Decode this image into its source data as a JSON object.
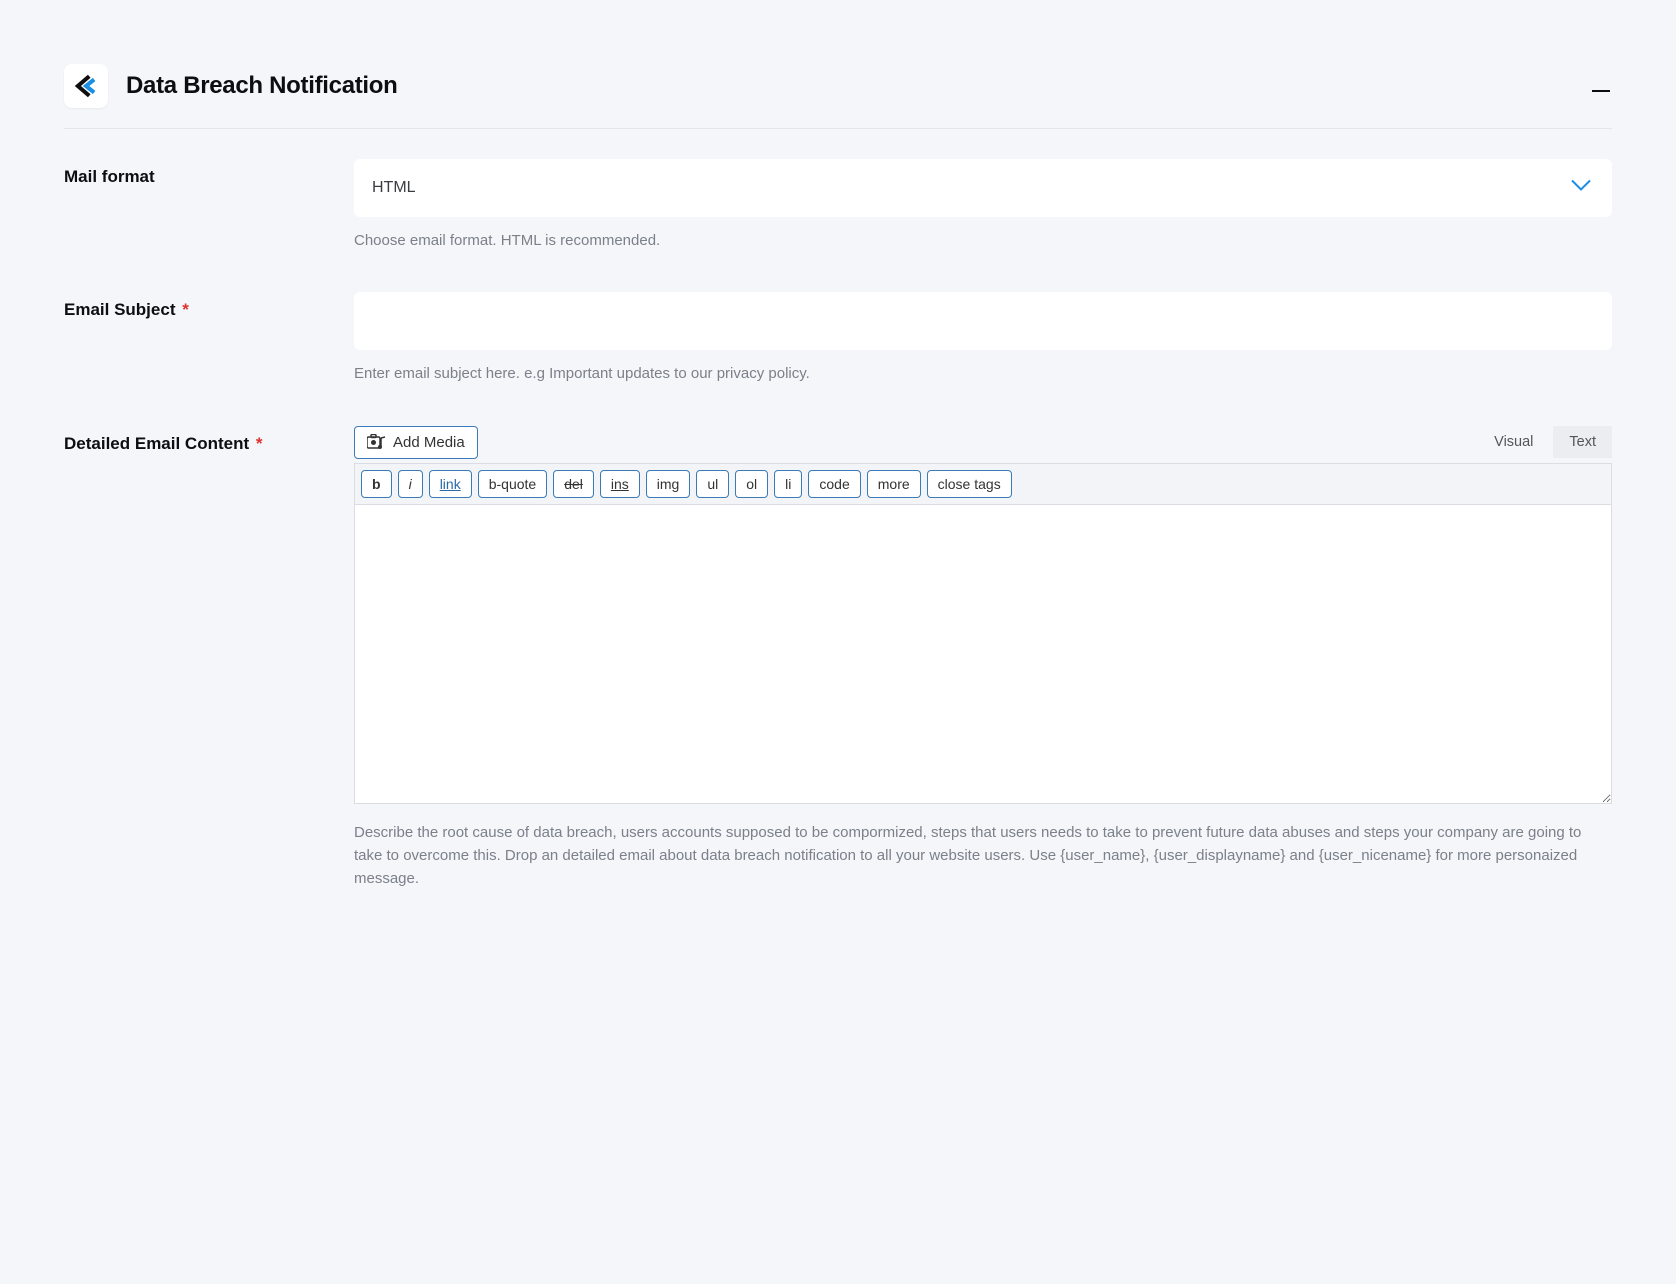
{
  "panel": {
    "title": "Data Breach Notification"
  },
  "mail_format": {
    "label": "Mail format",
    "value": "HTML",
    "help": "Choose email format. HTML is recommended."
  },
  "email_subject": {
    "label": "Email Subject",
    "required_marker": "*",
    "value": "",
    "help": "Enter email subject here. e.g Important updates to our privacy policy."
  },
  "email_content": {
    "label": "Detailed Email Content",
    "required_marker": "*",
    "add_media_label": "Add Media",
    "tabs": {
      "visual": "Visual",
      "text": "Text"
    },
    "qt_buttons": {
      "b": "b",
      "i": "i",
      "link": "link",
      "bquote": "b-quote",
      "del": "del",
      "ins": "ins",
      "img": "img",
      "ul": "ul",
      "ol": "ol",
      "li": "li",
      "code": "code",
      "more": "more",
      "close": "close tags"
    },
    "value": "",
    "help": "Describe the root cause of data breach, users accounts supposed to be compormized, steps that users needs to take to prevent future data abuses and steps your company are going to take to overcome this. Drop an detailed email about data breach notification to all your website users. Use {user_name}, {user_displayname} and {user_nicename} for more personaized message."
  }
}
